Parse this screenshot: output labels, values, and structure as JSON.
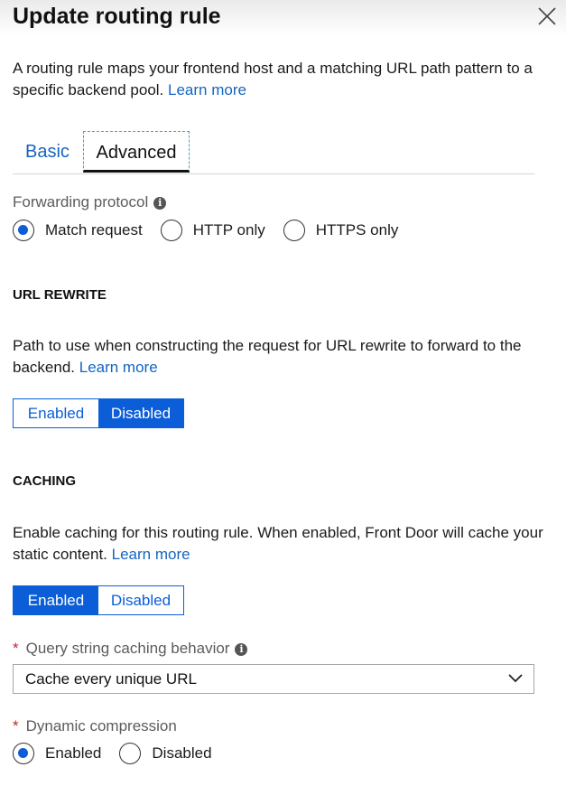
{
  "header": {
    "title": "Update routing rule",
    "close_icon": "close-icon"
  },
  "intro": {
    "text": "A routing rule maps your frontend host and a matching URL path pattern to a specific backend pool.",
    "link": "Learn more"
  },
  "tabs": [
    {
      "label": "Basic",
      "selected": false
    },
    {
      "label": "Advanced",
      "selected": true
    }
  ],
  "forwarding": {
    "label": "Forwarding protocol",
    "info_icon": "info-icon",
    "options": [
      "Match request",
      "HTTP only",
      "HTTPS only"
    ],
    "selected": "Match request"
  },
  "url_rewrite": {
    "heading": "URL REWRITE",
    "text": "Path to use when constructing the request for URL rewrite to forward to the backend.",
    "link": "Learn more",
    "enabled_label": "Enabled",
    "disabled_label": "Disabled",
    "selected": "Disabled"
  },
  "caching": {
    "heading": "CACHING",
    "text": "Enable caching for this routing rule. When enabled, Front Door will cache your static content.",
    "link": "Learn more",
    "enabled_label": "Enabled",
    "disabled_label": "Disabled",
    "selected": "Enabled"
  },
  "query_string": {
    "required_mark": "*",
    "label": "Query string caching behavior",
    "info_icon": "info-icon",
    "value": "Cache every unique URL",
    "chevron_icon": "chevron-down-icon"
  },
  "compression": {
    "required_mark": "*",
    "label": "Dynamic compression",
    "options": [
      "Enabled",
      "Disabled"
    ],
    "selected": "Enabled"
  },
  "colors": {
    "accent": "#0b5ed7",
    "link": "#1565c0",
    "required": "#c4262e"
  }
}
